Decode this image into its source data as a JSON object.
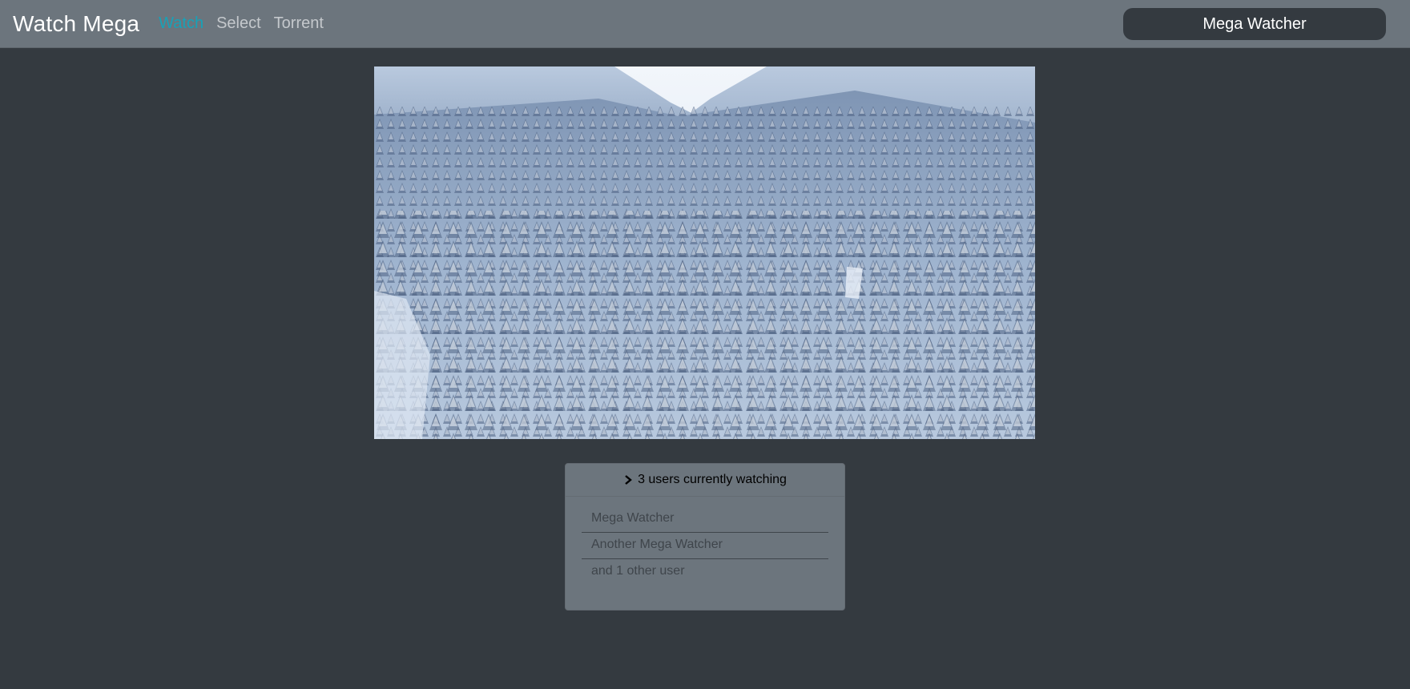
{
  "navbar": {
    "brand": "Watch Mega",
    "links": [
      {
        "label": "Watch",
        "active": true
      },
      {
        "label": "Select",
        "active": false
      },
      {
        "label": "Torrent",
        "active": false
      }
    ],
    "user": "Mega Watcher"
  },
  "video": {
    "content": "snowy-forest-valley"
  },
  "viewers": {
    "summary": "3 users currently watching",
    "items": [
      "Mega Watcher",
      "Another Mega Watcher",
      "and 1 other user"
    ]
  },
  "colors": {
    "navbar_bg": "#6c757d",
    "page_bg": "#343a40",
    "active_link": "#17a2b8"
  }
}
